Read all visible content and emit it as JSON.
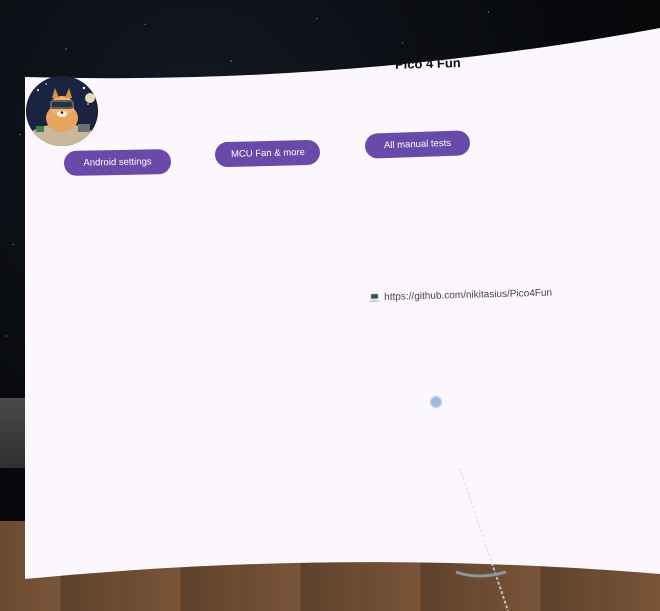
{
  "app": {
    "title": "Pico 4 Fun"
  },
  "buttons": {
    "android_settings": "Android settings",
    "mcu_fan": "MCU Fan & more",
    "manual_tests": "All manual tests"
  },
  "link": {
    "icon": "laptop-icon",
    "text": "https://github.com/nikitasius/Pico4Fun"
  },
  "colors": {
    "accent": "#6a4aa8",
    "panel": "#fcf7fd",
    "text": "#111111"
  }
}
